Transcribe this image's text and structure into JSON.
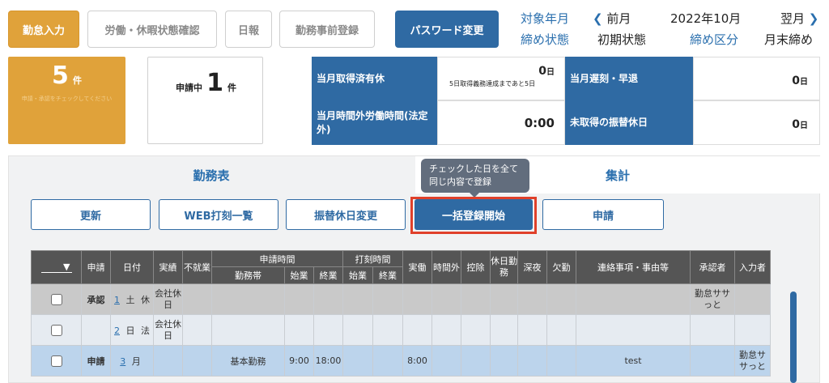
{
  "tabs": {
    "attendance_input": "勤怠入力",
    "labor_leave_status": "労働・休暇状態確認",
    "daily_report": "日報",
    "pre_registration": "勤務事前登録",
    "password_change": "パスワード変更"
  },
  "period": {
    "target_label": "対象年月",
    "prev": "前月",
    "year_month": "2022年10月",
    "next": "翌月",
    "closing_status_label": "締め状態",
    "closing_status_value": "初期状態",
    "closing_type_label": "締め区分",
    "closing_type_value": "月末締め"
  },
  "cards": {
    "orange_count": "5",
    "orange_unit": "件",
    "orange_sub": "申請・承認をチェックしてください",
    "pending_label": "申請中",
    "pending_count": "1",
    "pending_unit": "件"
  },
  "stats": {
    "paid_leave_label": "当月取得済有休",
    "paid_leave_value": "0",
    "paid_leave_unit": "日",
    "paid_leave_note": "5日取得義務達成まであと5日",
    "late_early_label": "当月遅刻・早退",
    "late_early_value": "0",
    "late_early_unit": "日",
    "overtime_label": "当月時間外労働時間(法定外)",
    "overtime_value": "0:00",
    "substitute_label": "未取得の振替休日",
    "substitute_value": "0",
    "substitute_unit": "日"
  },
  "panel": {
    "tab_schedule": "勤務表",
    "tab_summary": "集計",
    "tooltip": "チェックした日を全て同じ内容で登録",
    "buttons": {
      "refresh": "更新",
      "web_clock_list": "WEB打刻一覧",
      "substitute_change": "振替休日変更",
      "bulk_register": "一括登録開始",
      "apply": "申請"
    }
  },
  "table": {
    "headers": {
      "select": "▼",
      "apply": "申請",
      "date": "日付",
      "actual": "実績",
      "no_work": "不就業",
      "apply_time": "申請時間",
      "shift": "勤務帯",
      "start": "始業",
      "end": "終業",
      "clock_time": "打刻時間",
      "clock_start": "始業",
      "clock_end": "終業",
      "real_work": "実働",
      "overtime": "時間外",
      "deduction": "控除",
      "holiday_work": "休日勤務",
      "late_night": "深夜",
      "absence": "欠勤",
      "notes": "連絡事項・事由等",
      "approver": "承認者",
      "entered_by": "入力者"
    },
    "rows": [
      {
        "status": "承認",
        "day": "1",
        "weekday": "土",
        "holiday": "休",
        "actual": "会社休日",
        "shift": "",
        "start": "",
        "end": "",
        "real": "",
        "notes": "",
        "approver": "勤怠ササっと",
        "entered_by": ""
      },
      {
        "status": "",
        "day": "2",
        "weekday": "日",
        "holiday": "法",
        "actual": "会社休日",
        "shift": "",
        "start": "",
        "end": "",
        "real": "",
        "notes": "",
        "approver": "",
        "entered_by": ""
      },
      {
        "status": "申請",
        "day": "3",
        "weekday": "月",
        "holiday": "",
        "actual": "",
        "shift": "基本勤務",
        "start": "9:00",
        "end": "18:00",
        "real": "8:00",
        "notes": "test",
        "approver": "",
        "entered_by": "勤怠ササっと"
      }
    ]
  },
  "colors": {
    "orange": "#e0a23a",
    "blue": "#2f6aa3",
    "highlight_red": "#e0402a",
    "table_header": "#555555"
  }
}
